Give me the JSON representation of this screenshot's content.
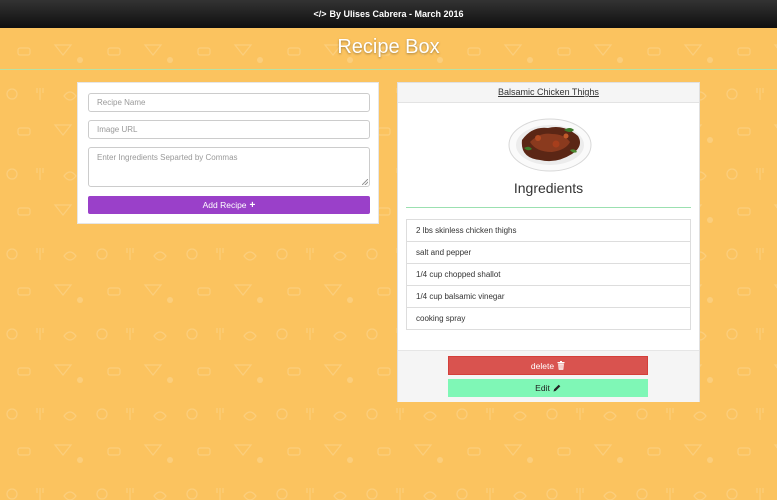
{
  "topbar": {
    "code_icon": "</>",
    "credit": "By Ulises Cabrera - March 2016"
  },
  "page": {
    "title": "Recipe Box"
  },
  "form": {
    "recipe_name_placeholder": "Recipe Name",
    "image_url_placeholder": "Image URL",
    "ingredients_placeholder": "Enter Ingredients Separted by Commas",
    "add_button_label": "Add Recipe",
    "add_icon": "+"
  },
  "recipe": {
    "name": "Balsamic Chicken Thighs",
    "ingredients_heading": "Ingredients",
    "ingredients": [
      "2 lbs skinless chicken thighs",
      "salt and pepper",
      "1/4 cup chopped shallot",
      "1/4 cup balsamic vinegar",
      "cooking spray"
    ],
    "delete_label": "delete",
    "edit_label": "Edit"
  },
  "colors": {
    "background": "#fbc35f",
    "add_button": "#9a40c9",
    "delete_button": "#d9534f",
    "edit_button": "#7ff7b6"
  },
  "icons": {
    "code": "code-icon",
    "add": "plus-icon",
    "delete": "trash-icon",
    "edit": "pencil-icon"
  }
}
